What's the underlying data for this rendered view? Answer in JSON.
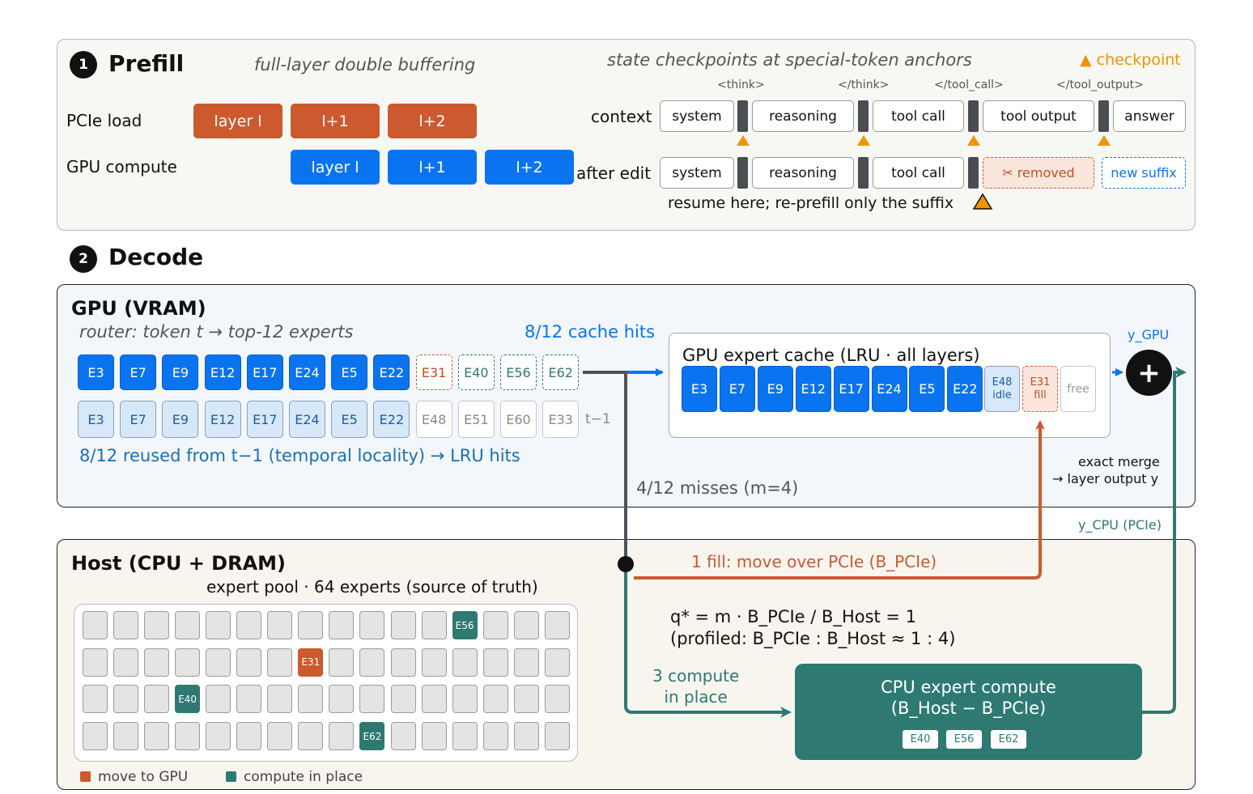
{
  "colors": {
    "pcie": "#cc5a2e",
    "gpu": "#0a74f0",
    "host": "#2e7a72",
    "checkpoint": "#f29400"
  },
  "prefill": {
    "step": "1",
    "title": "Prefill",
    "subtitle": "full-layer double buffering",
    "pcie_label": "PCIe load",
    "gpu_label": "GPU compute",
    "pcie_blocks": [
      "layer l",
      "l+1",
      "l+2"
    ],
    "gpu_blocks": [
      "layer l",
      "l+1",
      "l+2"
    ],
    "checkpoint_title": "state checkpoints at special-token anchors",
    "checkpoint_legend": "▲ checkpoint",
    "anchors": [
      "<think>",
      "</think>",
      "</tool_call>",
      "</tool_output>"
    ],
    "context_label": "context",
    "context_segments": [
      "system",
      "reasoning",
      "tool call",
      "tool output",
      "answer"
    ],
    "after_label": "after edit",
    "after_segments": [
      "system",
      "reasoning",
      "tool call"
    ],
    "removed": "✂ removed",
    "new_suffix": "new suffix",
    "resume_note": "resume here; re-prefill only the suffix"
  },
  "decode": {
    "step": "2",
    "title": "Decode",
    "gpu": {
      "title": "GPU (VRAM)",
      "router": "router: token t → top-12 experts",
      "cache_hits": "8/12 cache hits",
      "current": [
        "E3",
        "E7",
        "E9",
        "E12",
        "E17",
        "E24",
        "E5",
        "E22",
        "E31",
        "E40",
        "E56",
        "E62"
      ],
      "previous": [
        "E3",
        "E7",
        "E9",
        "E12",
        "E17",
        "E24",
        "E5",
        "E22",
        "E48",
        "E51",
        "E60",
        "E33"
      ],
      "prev_label": "t−1",
      "reuse_note": "8/12 reused from t−1 (temporal locality) → LRU hits",
      "misses": "4/12 misses (m=4)",
      "cache_title": "GPU expert cache (LRU · all layers)",
      "cache_slots": [
        "E3",
        "E7",
        "E9",
        "E12",
        "E17",
        "E24",
        "E5",
        "E22"
      ],
      "idle_slot": {
        "id": "E48",
        "state": "idle"
      },
      "fill_slot": {
        "id": "E31",
        "state": "fill"
      },
      "free_slot": "free",
      "y_gpu": "y_GPU",
      "merge": "exact merge",
      "merge_out": "→ layer output y",
      "plus": "+"
    },
    "host": {
      "title": "Host (CPU + DRAM)",
      "pool_title": "expert pool · 64 experts (source of truth)",
      "fill_label": "1 fill: move over PCIe (B_PCIe)",
      "y_cpu": "y_CPU (PCIe)",
      "formula1": "q* = m · B_PCIe / B_Host = 1",
      "formula2": "(profiled: B_PCIe : B_Host ≈ 1 : 4)",
      "compute_line1": "3 compute",
      "compute_line2": "in place",
      "cpu_title1": "CPU expert compute",
      "cpu_title2": "(B_Host − B_PCIe)",
      "cpu_experts": [
        "E40",
        "E56",
        "E62"
      ],
      "legend_move": "move to GPU",
      "legend_compute": "compute in place",
      "pool_marked": [
        {
          "id": "E56",
          "row": 0,
          "col": 12,
          "kind": "compute"
        },
        {
          "id": "E31",
          "row": 1,
          "col": 7,
          "kind": "move"
        },
        {
          "id": "E40",
          "row": 2,
          "col": 3,
          "kind": "compute"
        },
        {
          "id": "E62",
          "row": 3,
          "col": 9,
          "kind": "compute"
        }
      ]
    }
  }
}
